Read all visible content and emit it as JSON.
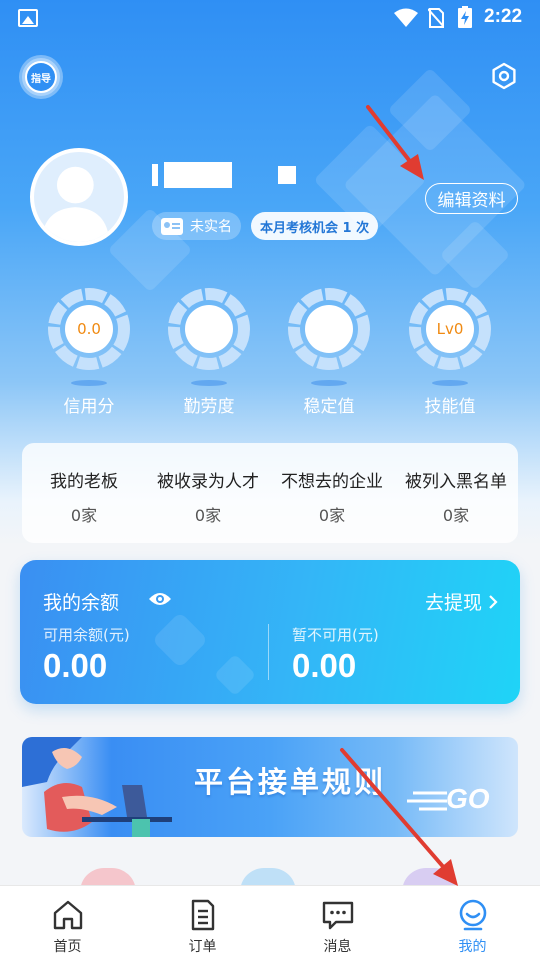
{
  "status_bar": {
    "time": "2:22"
  },
  "header": {
    "guide_label": "指导"
  },
  "profile": {
    "tags": {
      "verification": "未实名",
      "assessment": "本月考核机会 1 次"
    },
    "edit_button": "编辑资料"
  },
  "gauges": [
    {
      "value": "0.0",
      "label": "信用分"
    },
    {
      "value": "",
      "label": "勤劳度"
    },
    {
      "value": "",
      "label": "稳定值"
    },
    {
      "value": "Lv0",
      "label": "技能值"
    }
  ],
  "relations": [
    {
      "title": "我的老板",
      "count": "0家"
    },
    {
      "title": "被收录为人才",
      "count": "0家"
    },
    {
      "title": "不想去的企业",
      "count": "0家"
    },
    {
      "title": "被列入黑名单",
      "count": "0家"
    }
  ],
  "balance": {
    "title": "我的余额",
    "withdraw": "去提现",
    "available_label": "可用余额(元)",
    "available_value": "0.00",
    "unavailable_label": "暂不可用(元)",
    "unavailable_value": "0.00"
  },
  "banner": {
    "title": "平台接单规则",
    "go_text": "GO"
  },
  "tabbar": [
    {
      "label": "首页",
      "icon": "home-icon"
    },
    {
      "label": "订单",
      "icon": "order-icon"
    },
    {
      "label": "消息",
      "icon": "message-icon"
    },
    {
      "label": "我的",
      "icon": "profile-icon",
      "active": true
    }
  ],
  "colors": {
    "primary": "#2f8ff4",
    "score": "#f08a12"
  }
}
